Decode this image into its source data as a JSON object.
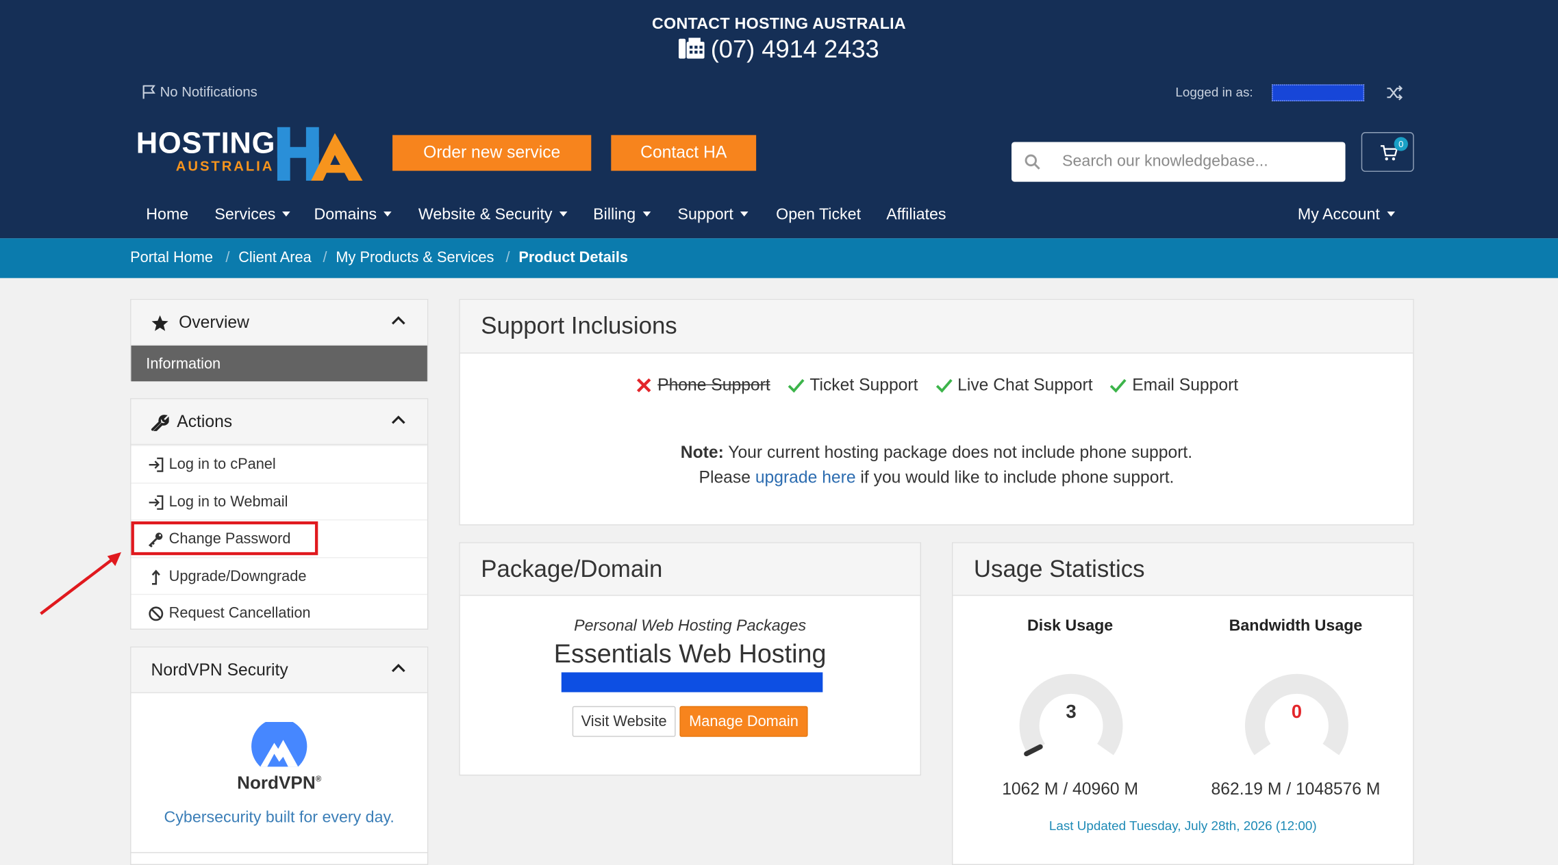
{
  "header": {
    "contact_title": "CONTACT HOSTING AUSTRALIA",
    "contact_phone": "(07) 4914 2433",
    "notifications": "No Notifications",
    "logged_in_label": "Logged in as:",
    "logo_word": "HOSTING",
    "logo_sub": "AUSTRALIA",
    "order_button": "Order new service",
    "contact_button": "Contact HA",
    "search_placeholder": "Search our knowledgebase...",
    "cart_count": "0",
    "accent_color": "#f7841d",
    "bg_color": "#152f56"
  },
  "nav": {
    "home": "Home",
    "services": "Services",
    "domains": "Domains",
    "website_security": "Website & Security",
    "billing": "Billing",
    "support": "Support",
    "open_ticket": "Open Ticket",
    "affiliates": "Affiliates",
    "my_account": "My Account"
  },
  "breadcrumb": {
    "portal_home": "Portal Home",
    "client_area": "Client Area",
    "products": "My Products & Services",
    "current": "Product Details"
  },
  "sidebar": {
    "overview_title": "Overview",
    "information": "Information",
    "actions_title": "Actions",
    "actions": [
      {
        "label": "Log in to cPanel",
        "icon": "sign-in-icon"
      },
      {
        "label": "Log in to Webmail",
        "icon": "sign-in-icon"
      },
      {
        "label": "Change Password",
        "icon": "key-icon"
      },
      {
        "label": "Upgrade/Downgrade",
        "icon": "level-up-icon"
      },
      {
        "label": "Request Cancellation",
        "icon": "ban-icon"
      }
    ],
    "nord_title": "NordVPN Security",
    "nord_brand": "NordVPN",
    "nord_tagline": "Cybersecurity built for every day."
  },
  "support": {
    "title": "Support Inclusions",
    "items": [
      {
        "label": "Phone Support",
        "included": false
      },
      {
        "label": "Ticket Support",
        "included": true
      },
      {
        "label": "Live Chat Support",
        "included": true
      },
      {
        "label": "Email Support",
        "included": true
      }
    ],
    "note_label": "Note:",
    "note_line1": "Your current hosting package does not include phone support.",
    "note_please": "Please",
    "note_link": "upgrade here",
    "note_rest": "if you would like to include phone support."
  },
  "package": {
    "title": "Package/Domain",
    "group": "Personal Web Hosting Packages",
    "name": "Essentials Web Hosting",
    "visit_button": "Visit Website",
    "manage_button": "Manage Domain"
  },
  "usage": {
    "title": "Usage Statistics",
    "disk_title": "Disk Usage",
    "disk_percent": "3",
    "disk_numbers": "1062 M / 40960 M",
    "bandwidth_title": "Bandwidth Usage",
    "bandwidth_percent": "0",
    "bandwidth_numbers": "862.19 M / 1048576 M",
    "last_updated": "Last Updated Tuesday, July 28th, 2026 (12:00)"
  }
}
